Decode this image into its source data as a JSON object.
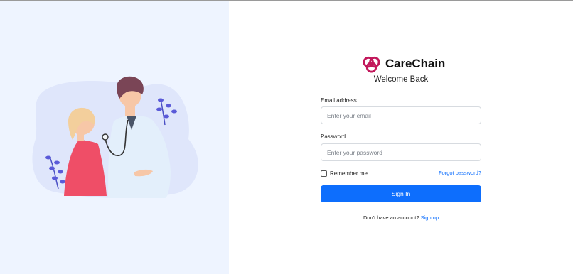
{
  "brand": {
    "name": "CareChain",
    "logo_icon": "carechain-knot-logo-icon",
    "color": "#c2185b"
  },
  "login": {
    "welcome": "Welcome Back",
    "email_label": "Email address",
    "email_placeholder": "Enter your email",
    "email_value": "",
    "password_label": "Password",
    "password_placeholder": "Enter your password",
    "password_value": "",
    "remember_label": "Remember me",
    "remember_checked": false,
    "forgot_label": "Forgot password?",
    "signin_label": "Sign In",
    "signup_prompt": "Don't have an account?",
    "signup_link": "Sign up"
  },
  "illustration": {
    "icon": "doctor-patient-illustration"
  },
  "colors": {
    "primary": "#0d6efd",
    "left_panel_bg": "#eef4ff",
    "blob": "#dfe6fb",
    "leaf": "#5a5ad8",
    "patient_top": "#ef4e67"
  }
}
